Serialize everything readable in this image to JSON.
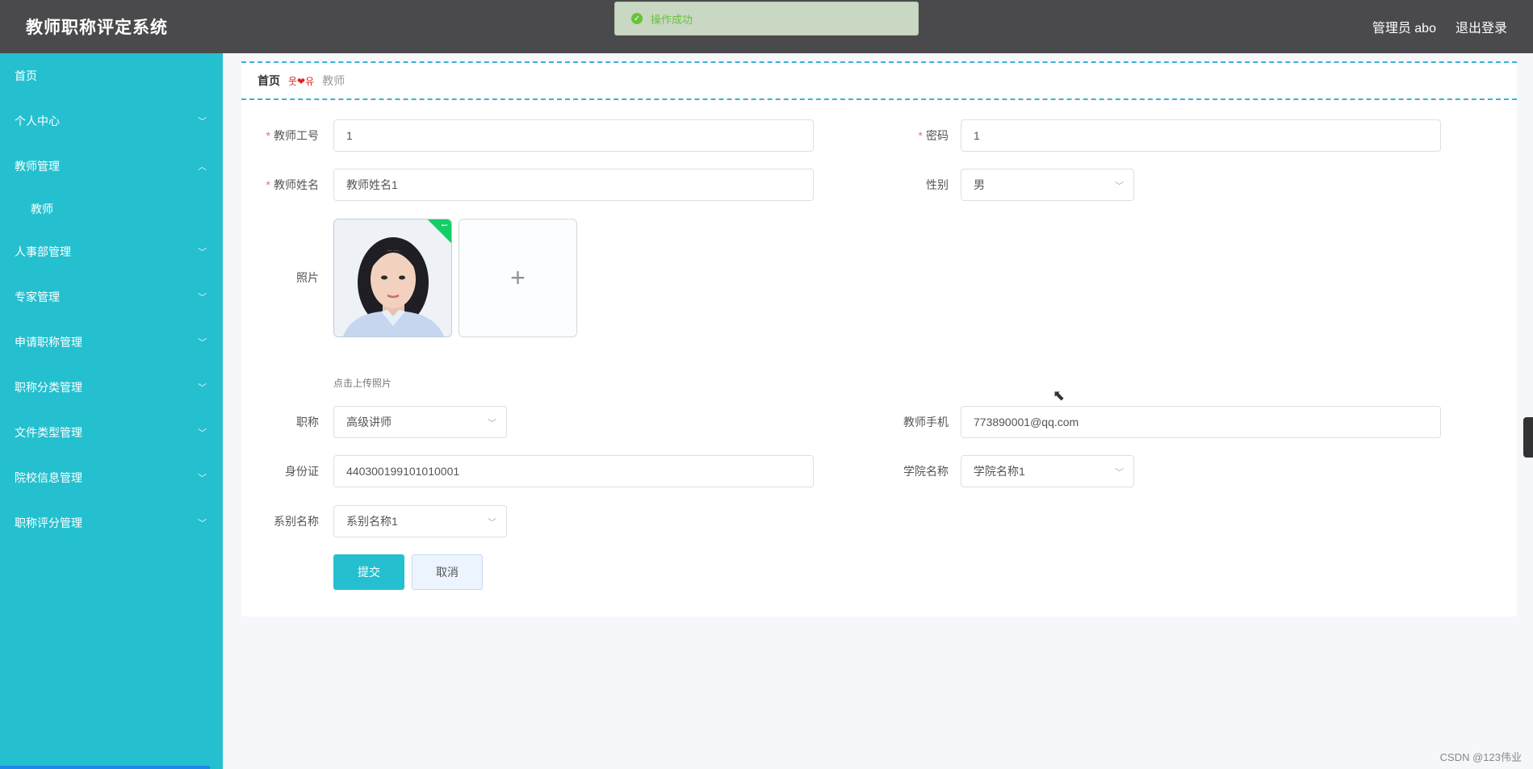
{
  "app": {
    "title": "教师职称评定系统"
  },
  "header": {
    "user": "管理员 abo",
    "logout": "退出登录"
  },
  "toast": {
    "message": "操作成功"
  },
  "sidebar": {
    "items": [
      {
        "label": "首页"
      },
      {
        "label": "个人中心"
      },
      {
        "label": "教师管理"
      },
      {
        "label": "人事部管理"
      },
      {
        "label": "专家管理"
      },
      {
        "label": "申请职称管理"
      },
      {
        "label": "职称分类管理"
      },
      {
        "label": "文件类型管理"
      },
      {
        "label": "院校信息管理"
      },
      {
        "label": "职称评分管理"
      }
    ],
    "submenu": {
      "label": "教师"
    }
  },
  "breadcrumb": {
    "home": "首页",
    "current": "教师"
  },
  "form": {
    "teacher_id": {
      "label": "教师工号",
      "value": "1"
    },
    "password": {
      "label": "密码",
      "value": "1"
    },
    "teacher_name": {
      "label": "教师姓名",
      "value": "教师姓名1"
    },
    "gender": {
      "label": "性别",
      "value": "男"
    },
    "photo": {
      "label": "照片",
      "hint": "点击上传照片"
    },
    "title": {
      "label": "职称",
      "value": "高级讲师"
    },
    "phone": {
      "label": "教师手机",
      "value": "773890001@qq.com"
    },
    "id_card": {
      "label": "身份证",
      "value": "440300199101010001"
    },
    "college": {
      "label": "学院名称",
      "value": "学院名称1"
    },
    "department": {
      "label": "系别名称",
      "value": "系别名称1"
    },
    "submit": "提交",
    "cancel": "取消"
  },
  "watermark": "CSDN @123伟业"
}
